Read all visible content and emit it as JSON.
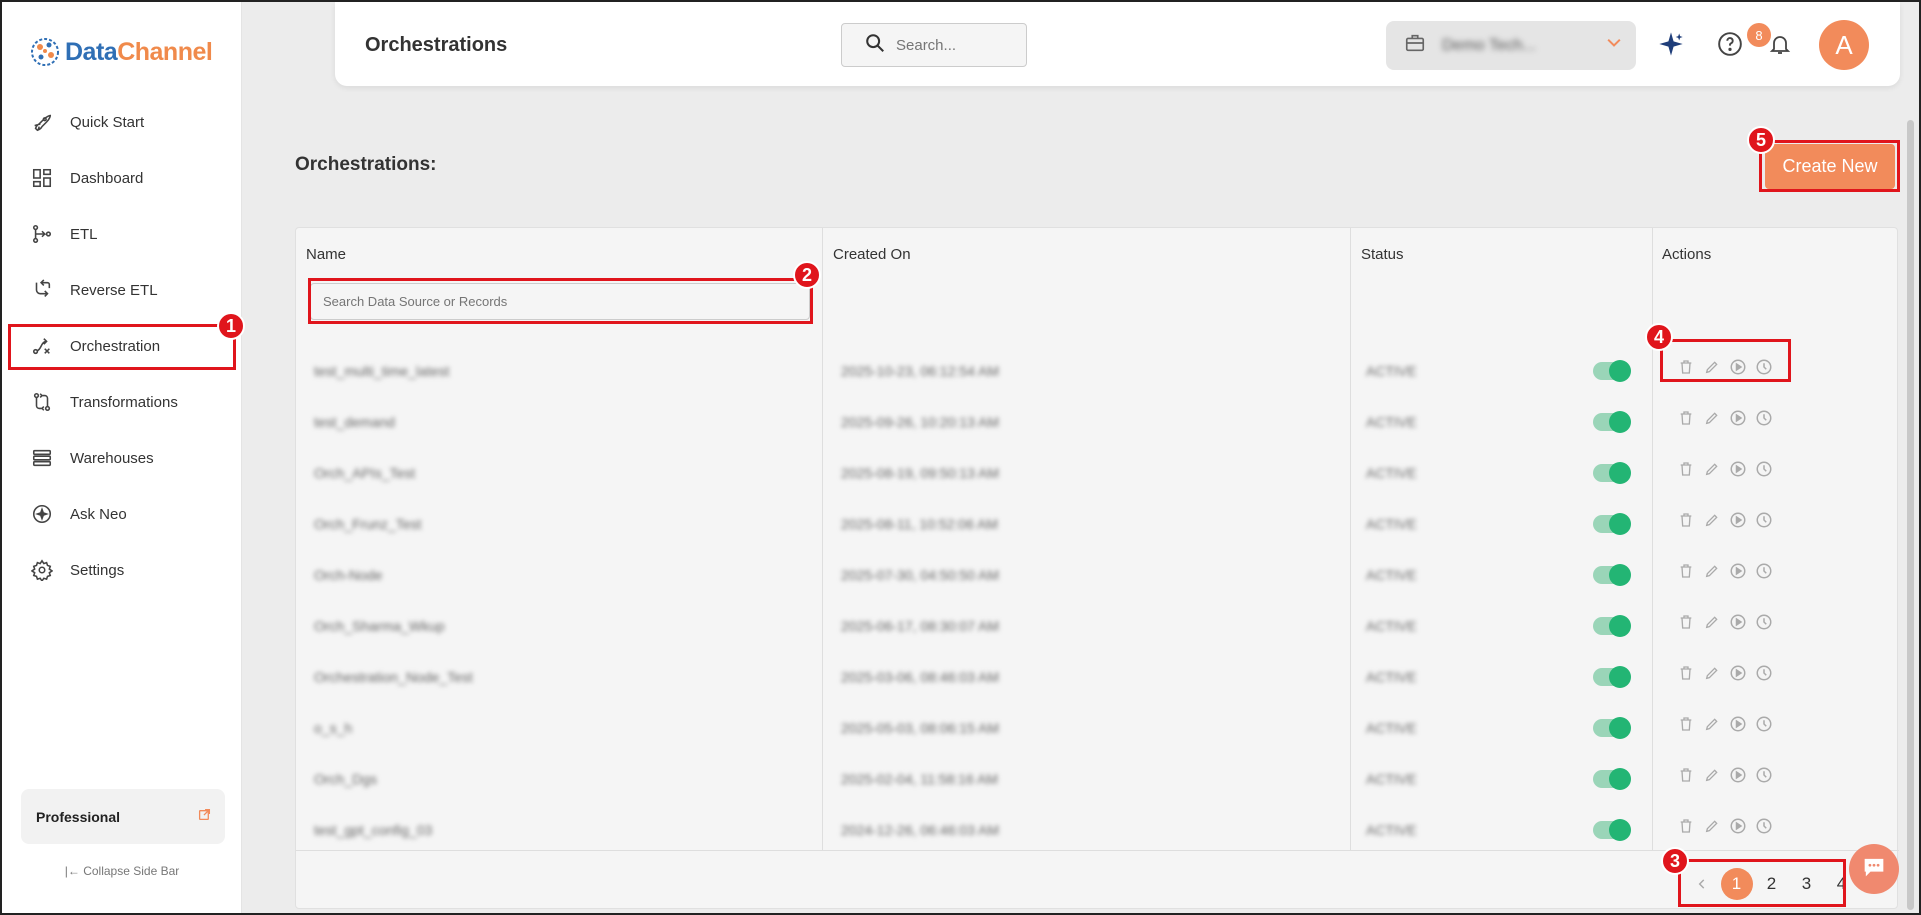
{
  "app": {
    "logo_part1": "Data",
    "logo_part2": "Channel"
  },
  "sidebar": {
    "items": [
      {
        "label": "Quick Start",
        "icon": "rocket-icon"
      },
      {
        "label": "Dashboard",
        "icon": "dashboard-icon"
      },
      {
        "label": "ETL",
        "icon": "etl-icon"
      },
      {
        "label": "Reverse ETL",
        "icon": "reverse-etl-icon"
      },
      {
        "label": "Orchestration",
        "icon": "orchestration-icon"
      },
      {
        "label": "Transformations",
        "icon": "transformations-icon"
      },
      {
        "label": "Warehouses",
        "icon": "warehouses-icon"
      },
      {
        "label": "Ask Neo",
        "icon": "ask-neo-icon"
      },
      {
        "label": "Settings",
        "icon": "settings-icon"
      }
    ],
    "plan": "Professional",
    "collapse_label": "Collapse Side Bar"
  },
  "header": {
    "title": "Orchestrations",
    "search_placeholder": "Search...",
    "workspace_name": "Demo Tech...",
    "notification_badge": "8",
    "avatar_letter": "A"
  },
  "main": {
    "heading": "Orchestrations:",
    "create_label": "Create New",
    "table": {
      "columns": [
        "Name",
        "Created On",
        "Status",
        "Actions"
      ],
      "filter_placeholder": "Search Data Source or Records",
      "rows": [
        {
          "name": "test_multi_time_latest",
          "created": "2025-10-23, 06:12:54 AM",
          "status": "ACTIVE"
        },
        {
          "name": "test_demand",
          "created": "2025-09-26, 10:20:13 AM",
          "status": "ACTIVE"
        },
        {
          "name": "Orch_APIs_Test",
          "created": "2025-08-19, 09:50:13 AM",
          "status": "ACTIVE"
        },
        {
          "name": "Orch_Frunz_Test",
          "created": "2025-08-11, 10:52:06 AM",
          "status": "ACTIVE"
        },
        {
          "name": "Orch-Node",
          "created": "2025-07-30, 04:50:50 AM",
          "status": "ACTIVE"
        },
        {
          "name": "Orch_Sharma_Wkup",
          "created": "2025-06-17, 08:30:07 AM",
          "status": "ACTIVE"
        },
        {
          "name": "Orchestration_Node_Test",
          "created": "2025-03-06, 08:46:03 AM",
          "status": "ACTIVE"
        },
        {
          "name": "o_s_h",
          "created": "2025-05-03, 08:06:15 AM",
          "status": "ACTIVE"
        },
        {
          "name": "Orch_Dgs",
          "created": "2025-02-04, 11:58:16 AM",
          "status": "ACTIVE"
        },
        {
          "name": "test_gpt_config_03",
          "created": "2024-12-26, 06:46:03 AM",
          "status": "ACTIVE"
        }
      ]
    },
    "pagination": [
      "1",
      "2",
      "3",
      "4"
    ]
  },
  "annotations": [
    "1",
    "2",
    "3",
    "4",
    "5"
  ],
  "colors": {
    "accent": "#f28b5b",
    "toggle_on": "#23b574",
    "annotation": "#e0151c",
    "logo_blue": "#2f6fb5"
  }
}
